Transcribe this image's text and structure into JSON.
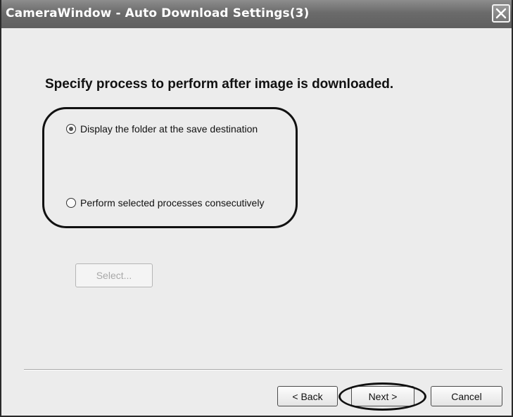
{
  "window": {
    "title": "CameraWindow - Auto Download Settings(3)",
    "close_icon": "close-icon"
  },
  "main": {
    "heading": "Specify process to perform after image is downloaded.",
    "options": [
      {
        "label": "Display the folder at the save destination",
        "selected": true
      },
      {
        "label": "Perform selected processes consecutively",
        "selected": false
      }
    ],
    "select_button": {
      "label": "Select...",
      "enabled": false
    }
  },
  "footer": {
    "back_label": "< Back",
    "next_label": "Next >",
    "cancel_label": "Cancel"
  }
}
